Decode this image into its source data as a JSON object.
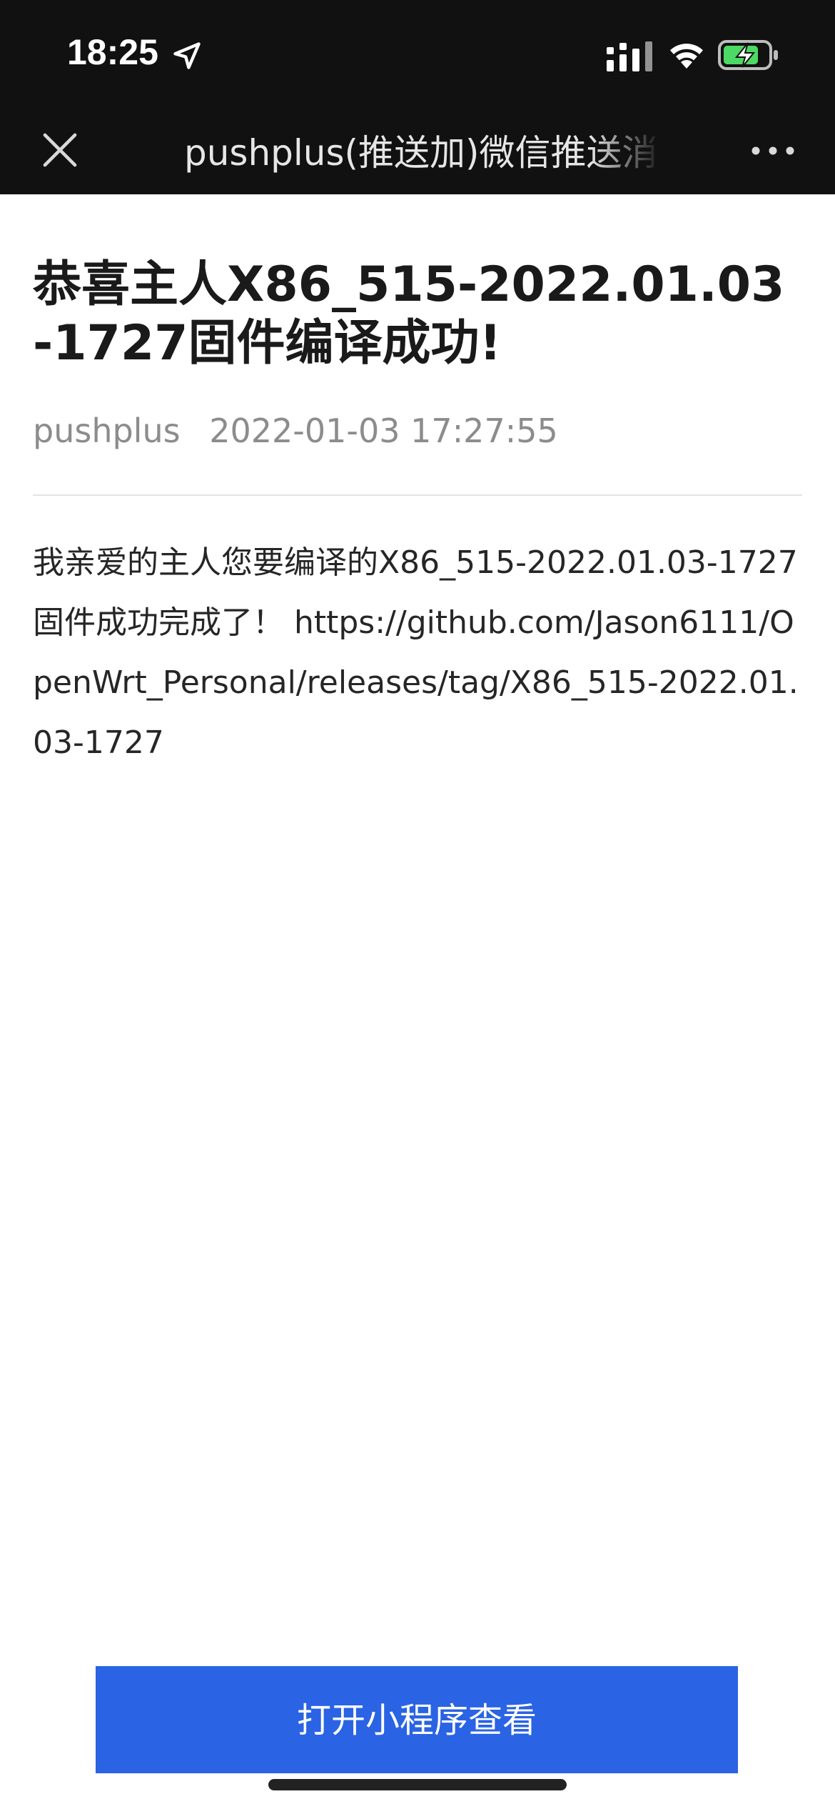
{
  "status_bar": {
    "time": "18:25",
    "icons": [
      "location-arrow-icon",
      "signal-icon",
      "wifi-icon",
      "battery-charging-icon"
    ],
    "battery_color": "#4cd964"
  },
  "nav": {
    "title": "pushplus(推送加)微信推送消",
    "close_icon": "close-icon",
    "more_icon": "more-icon"
  },
  "article": {
    "title": "恭喜主人X86_515-2022.01.03-1727固件编译成功!",
    "author": "pushplus",
    "datetime": "2022-01-03 17:27:55",
    "body": "我亲爱的主人您要编译的X86_515-2022.01.03-1727固件成功完成了！ https://github.com/Jason6111/OpenWrt_Personal/releases/tag/X86_515-2022.01.03-1727"
  },
  "footer": {
    "button_label": "打开小程序查看",
    "button_color": "#2a63e3"
  }
}
